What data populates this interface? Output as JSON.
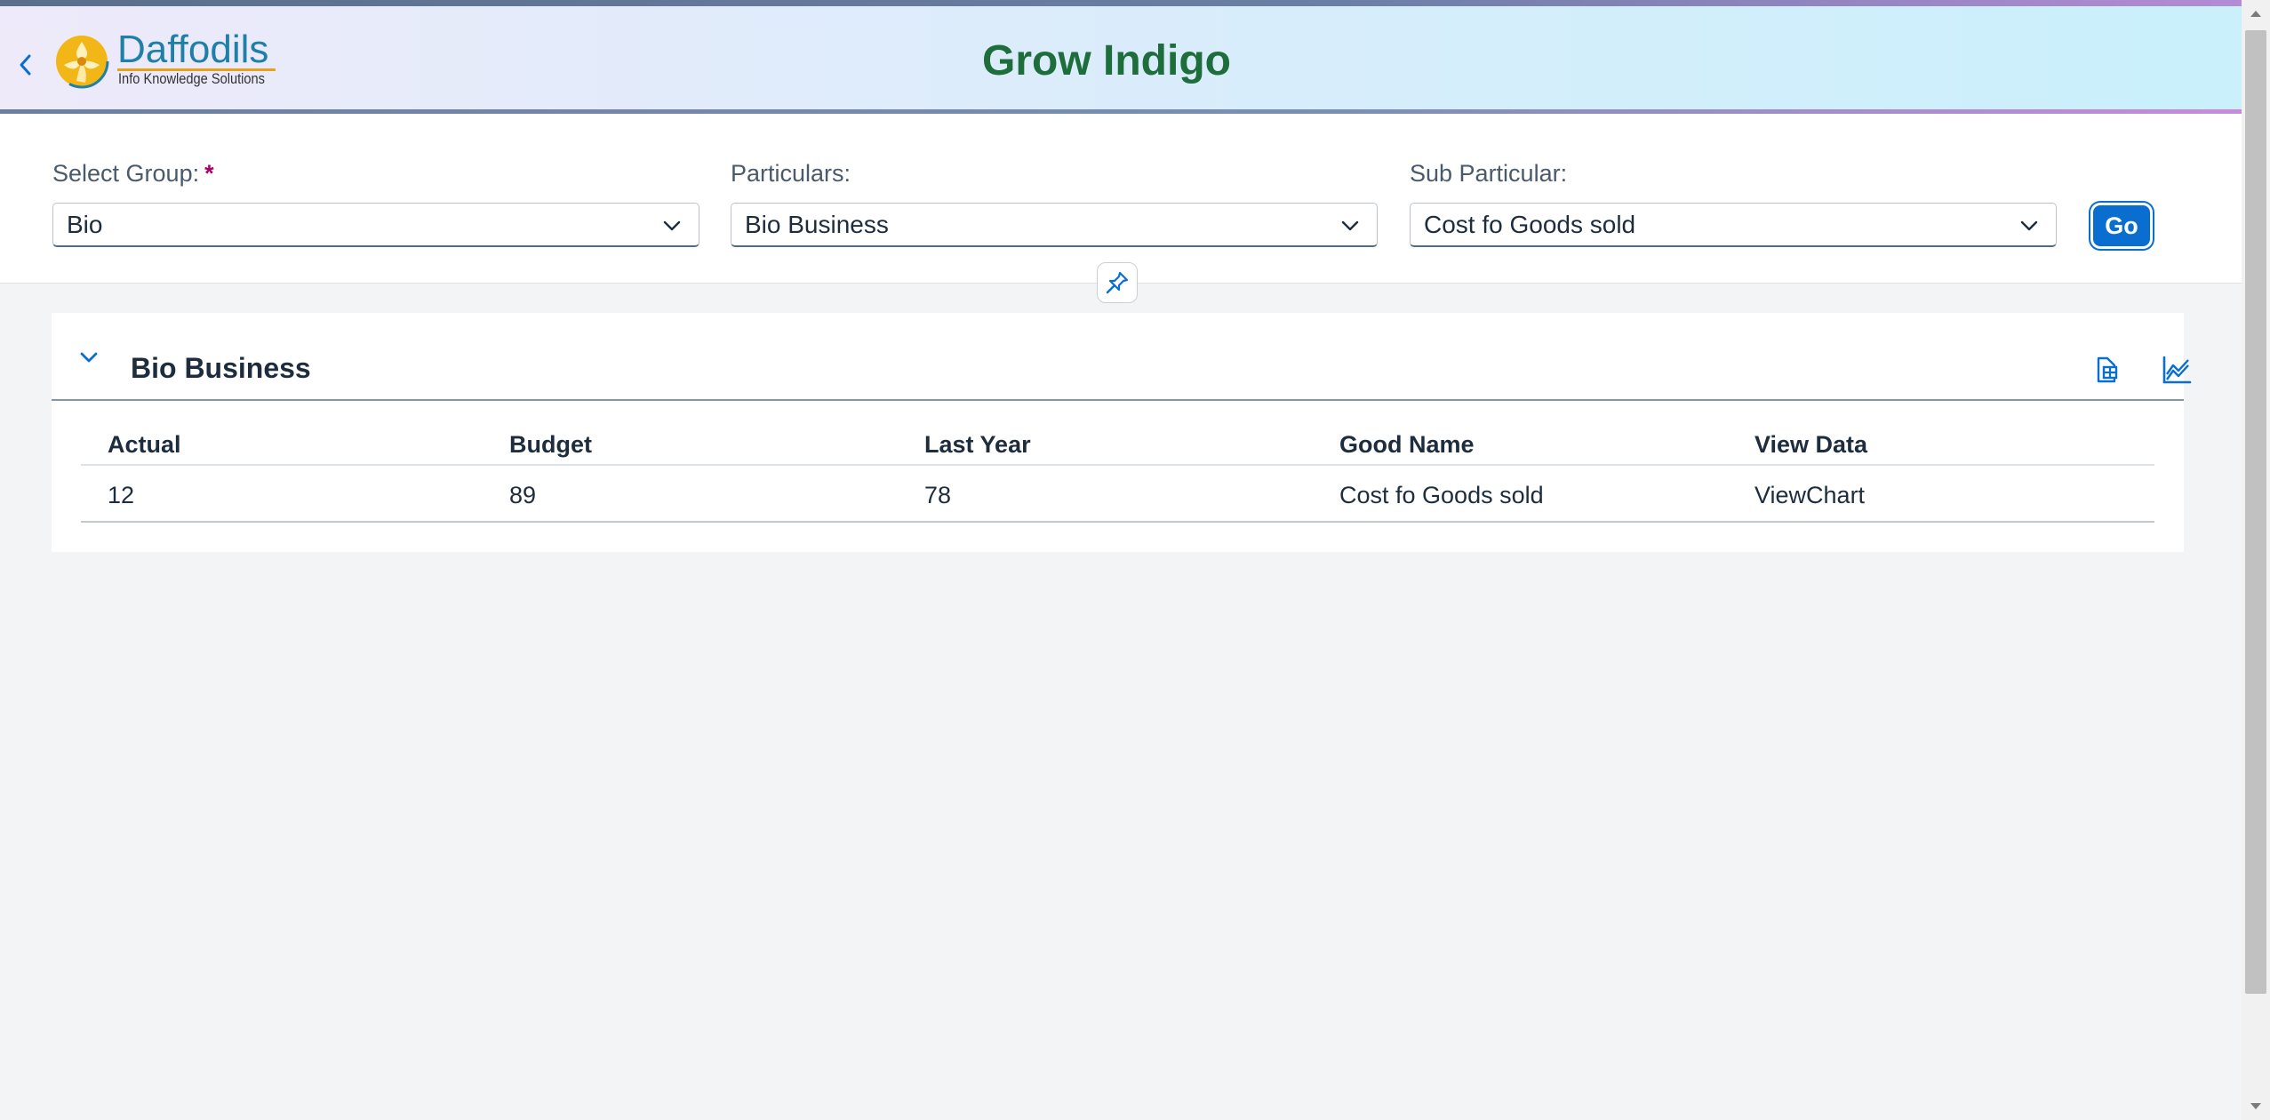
{
  "header": {
    "app_title": "Grow Indigo",
    "logo_name": "Daffodils",
    "logo_tagline": "Info Knowledge Solutions"
  },
  "filters": {
    "group_label": "Select Group:",
    "group_required": "*",
    "group_value": "Bio",
    "particulars_label": "Particulars:",
    "particulars_value": "Bio Business",
    "sub_particular_label": "Sub Particular:",
    "sub_particular_value": "Cost fo Goods sold",
    "go_label": "Go"
  },
  "panel": {
    "title": "Bio Business",
    "columns": [
      "Actual",
      "Budget",
      "Last Year",
      "Good Name",
      "View Data"
    ],
    "rows": [
      {
        "actual": "12",
        "budget": "89",
        "last_year": "78",
        "good_name": "Cost fo Goods sold",
        "view_data": "ViewChart"
      }
    ]
  },
  "colors": {
    "accent": "#0a6ed1",
    "title_green": "#1e6e3c",
    "required_mark": "#aa0066"
  }
}
